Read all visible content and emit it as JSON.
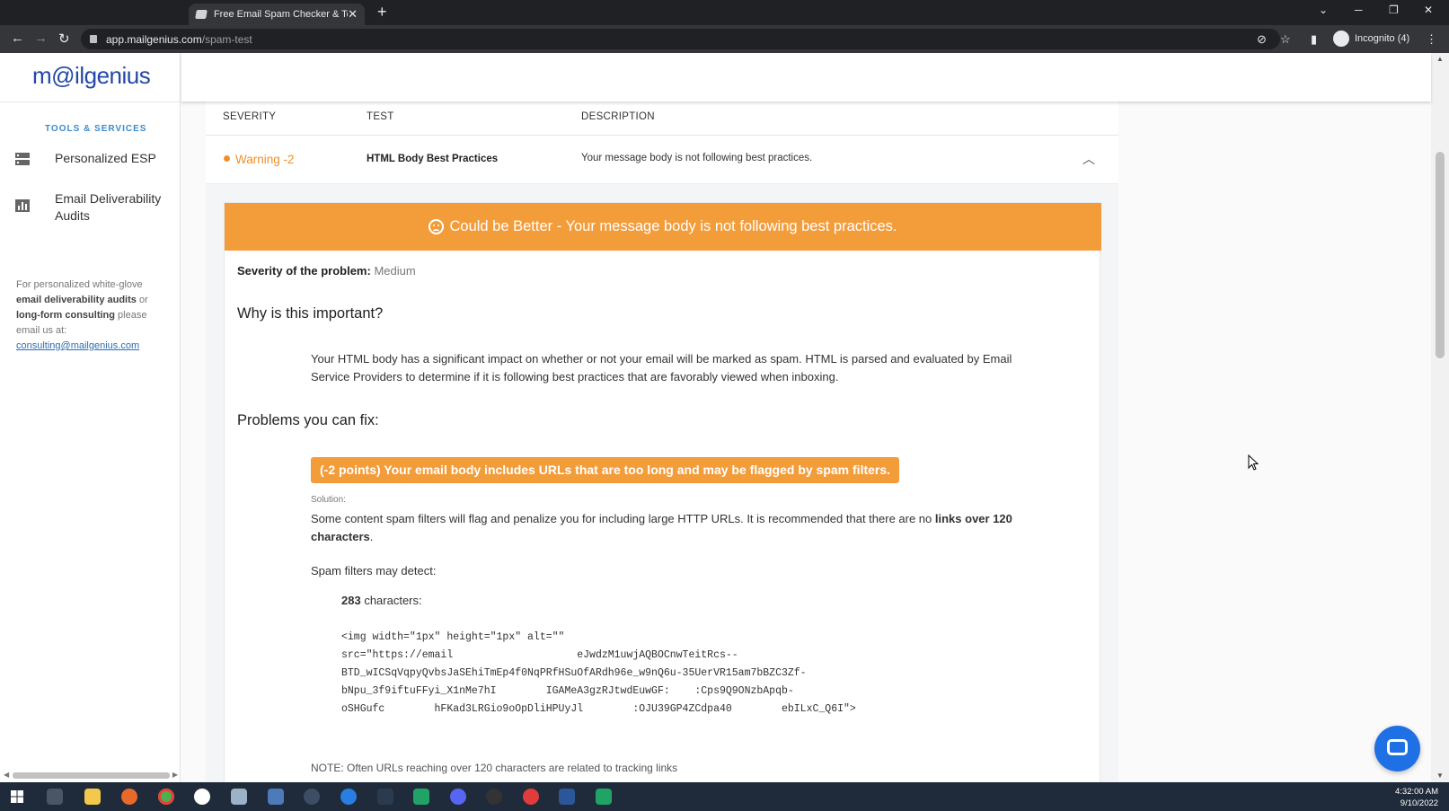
{
  "browser": {
    "tab_title": "Free Email Spam Checker & Testi",
    "url_host": "app.mailgenius.com",
    "url_path": "/spam-test",
    "profile_label": "Incognito (4)"
  },
  "sidebar": {
    "logo": "m@ilgenius",
    "section_title": "TOOLS & SERVICES",
    "items": [
      {
        "label": "Personalized ESP",
        "icon": "server-icon"
      },
      {
        "label": "Email Deliverability Audits",
        "icon": "bar-chart-icon"
      }
    ],
    "note_prefix": "For personalized white-glove ",
    "note_bold1": "email deliverability audits",
    "note_mid": " or ",
    "note_bold2": "long-form consulting",
    "note_suffix": " please email us at:",
    "note_email": "consulting@mailgenius.com"
  },
  "table": {
    "headers": [
      "SEVERITY",
      "TEST",
      "DESCRIPTION"
    ],
    "row": {
      "severity": "Warning -2",
      "test": "HTML Body Best Practices",
      "description": "Your message body is not following best practices."
    }
  },
  "detail": {
    "banner": "Could be Better - Your message body is not following best practices.",
    "severity_label": "Severity of the problem:",
    "severity_value": "Medium",
    "why_heading": "Why is this important?",
    "why_text": "Your HTML body has a significant impact on whether or not your email will be marked as spam. HTML is parsed and evaluated by Email Service Providers to determine if it is following best practices that are favorably viewed when inboxing.",
    "problems_heading": "Problems you can fix:",
    "problem_pill": "(-2 points) Your email body includes URLs that are too long and may be flagged by spam filters.",
    "solution_label": "Solution:",
    "solution_text": "Some content spam filters will flag and penalize you for including large HTTP URLs. It is recommended that there are no ",
    "solution_bold": "links over 120 characters",
    "solution_end": ".",
    "detect_label": "Spam filters may detect:",
    "char_count": "283",
    "char_label": " characters:",
    "code": "<img width=\"1px\" height=\"1px\" alt=\"\"\nsrc=\"https://email                    eJwdzM1uwjAQBOCnwTeitRcs--\nBTD_wICSqVqpyQvbsJaSEhiTmEp4f0NqPRfHSuOfARdh96e_w9nQ6u-35UerVR15am7bBZC3Zf-\nbNpu_3f9iftuFFyi_X1nMe7hI        IGAMeA3gzRJtwdEuwGF:    :Cps9Q9ONzbApqb-\noSHGufc        hFKad3LRGio9oOpDliHPUyJl        :OJU39GP4ZCdpa40        ebILxC_Q6I\">",
    "note": "NOTE: Often URLs reaching over 120 characters are related to tracking links"
  },
  "taskbar": {
    "time": "4:32:00 AM",
    "date": "9/10/2022"
  }
}
